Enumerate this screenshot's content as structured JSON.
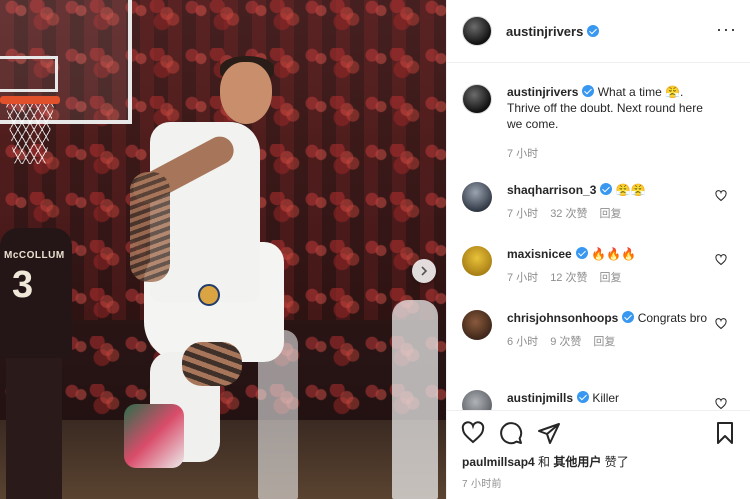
{
  "post": {
    "author": "austinjrivers",
    "caption_text": "What a time 😤. Thrive off the doubt. Next round here we come.",
    "caption_time": "7 小时"
  },
  "photo": {
    "jersey_name": "McCOLLUM",
    "jersey_number": "3"
  },
  "comments": [
    {
      "user": "shaqharrison_3",
      "verified": true,
      "text": "😤😤",
      "time": "7 小时",
      "likes": "32 次赞",
      "reply": "回复"
    },
    {
      "user": "maxisnicee",
      "verified": true,
      "text": "🔥🔥🔥",
      "time": "7 小时",
      "likes": "12 次赞",
      "reply": "回复"
    },
    {
      "user": "chrisjohnsonhoops",
      "verified": true,
      "text": "Congrats bro",
      "time": "6 小时",
      "likes": "9 次赞",
      "reply": "回复"
    },
    {
      "user": "austinjmills",
      "verified": true,
      "text": "Killer"
    }
  ],
  "footer": {
    "liked_by_user": "paulmillsap4",
    "liked_by_rest": " 和 ",
    "liked_by_others": "其他用户",
    "liked_suffix": " 赞了",
    "time_ago": "7 小时前"
  },
  "colors": {
    "verified": "#3897f0",
    "muted": "#8e8e8e",
    "text": "#262626"
  }
}
